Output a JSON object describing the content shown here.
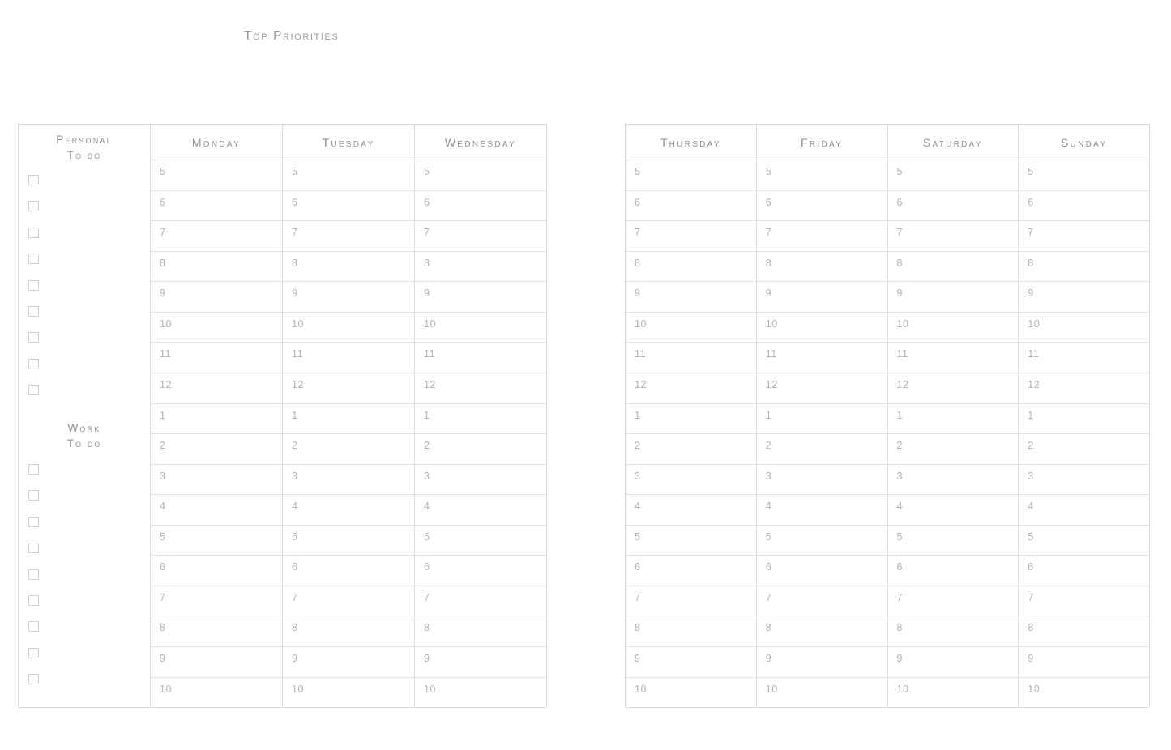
{
  "header": {
    "title": "Top Priorities"
  },
  "todo_sections": [
    {
      "name": "personal-todo",
      "line1": "Personal",
      "line2": "To do",
      "checkbox_count": 9
    },
    {
      "name": "work-todo",
      "line1": "Work",
      "line2": "To do",
      "checkbox_count": 9
    }
  ],
  "hours": [
    "5",
    "6",
    "7",
    "8",
    "9",
    "10",
    "11",
    "12",
    "1",
    "2",
    "3",
    "4",
    "5",
    "6",
    "7",
    "8",
    "9",
    "10"
  ],
  "panels": [
    {
      "name": "left-page",
      "has_todo_column": true,
      "days": [
        "Monday",
        "Tuesday",
        "Wednesday"
      ]
    },
    {
      "name": "right-page",
      "has_todo_column": false,
      "days": [
        "Thursday",
        "Friday",
        "Saturday",
        "Sunday"
      ]
    }
  ],
  "colors": {
    "border": "#dcdcdc",
    "row_rule": "#e2e2e2",
    "heading_text": "#8f8f8f",
    "hour_text": "#b2b2b2",
    "title_text": "#9a9a9a",
    "checkbox_border": "#cfcfcf",
    "background": "#ffffff"
  }
}
